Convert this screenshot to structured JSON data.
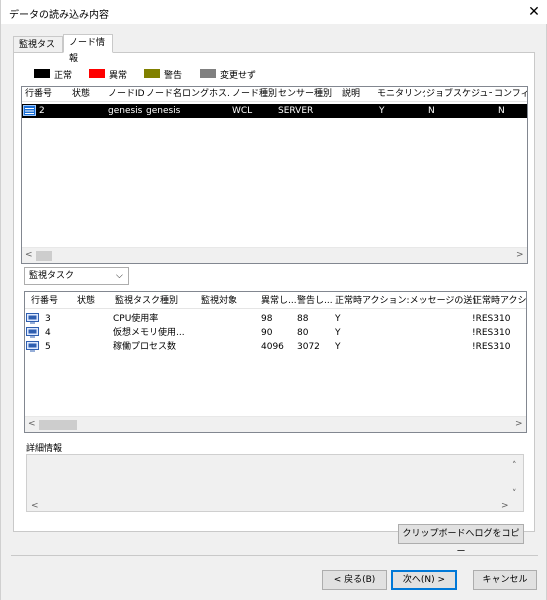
{
  "window": {
    "title": "データの読み込み内容",
    "close_glyph": "✕"
  },
  "tabs": [
    {
      "label": "監視タスク",
      "active": false
    },
    {
      "label": "ノード情報",
      "active": true
    }
  ],
  "legend": [
    {
      "label": "正常",
      "color": "#000000"
    },
    {
      "label": "異常",
      "color": "#ff0000"
    },
    {
      "label": "警告",
      "color": "#808000"
    },
    {
      "label": "変更せず",
      "color": "#808080"
    }
  ],
  "node_table": {
    "columns": [
      "行番号",
      "状態",
      "ノードID",
      "ノード名",
      "ロングホス...",
      "ノード種別",
      "センサー種別",
      "説明",
      "モニタリング",
      "ジョブスケジュール",
      "コンフィグ..."
    ],
    "rows": [
      {
        "row_no": "2",
        "status": "",
        "node_id": "genesis",
        "node_name": "genesis",
        "long_host": "",
        "node_type": "WCL",
        "sensor_type": "SERVER",
        "desc": "",
        "monitoring": "Y",
        "job_schedule": "N",
        "config": "N",
        "selected": true,
        "icon": "server-row-icon"
      }
    ]
  },
  "filter": {
    "selected": "監視タスク",
    "chevron": "⌵"
  },
  "task_table": {
    "columns": [
      "行番号",
      "状態",
      "監視タスク種別",
      "監視対象",
      "異常し...",
      "警告し...",
      "正常時アクション:メッセージの送信",
      "正常時アクシ"
    ],
    "rows": [
      {
        "row_no": "3",
        "status": "",
        "type": "CPU使用率",
        "target": "",
        "err": "98",
        "warn": "88",
        "msg": "Y",
        "action": "!RES310"
      },
      {
        "row_no": "4",
        "status": "",
        "type": "仮想メモリ使用...",
        "target": "",
        "err": "90",
        "warn": "80",
        "msg": "Y",
        "action": "!RES310"
      },
      {
        "row_no": "5",
        "status": "",
        "type": "稼働プロセス数",
        "target": "",
        "err": "4096",
        "warn": "3072",
        "msg": "Y",
        "action": "!RES310"
      }
    ]
  },
  "details": {
    "label": "詳細情報",
    "text": ""
  },
  "buttons": {
    "copy_clipboard": "クリップボードへログをコピー",
    "back": "< 戻る(B)",
    "next": "次へ(N) >",
    "cancel": "キャンセル"
  },
  "scroll": {
    "left": "<",
    "right": ">",
    "up": "˄",
    "down": "˅"
  }
}
